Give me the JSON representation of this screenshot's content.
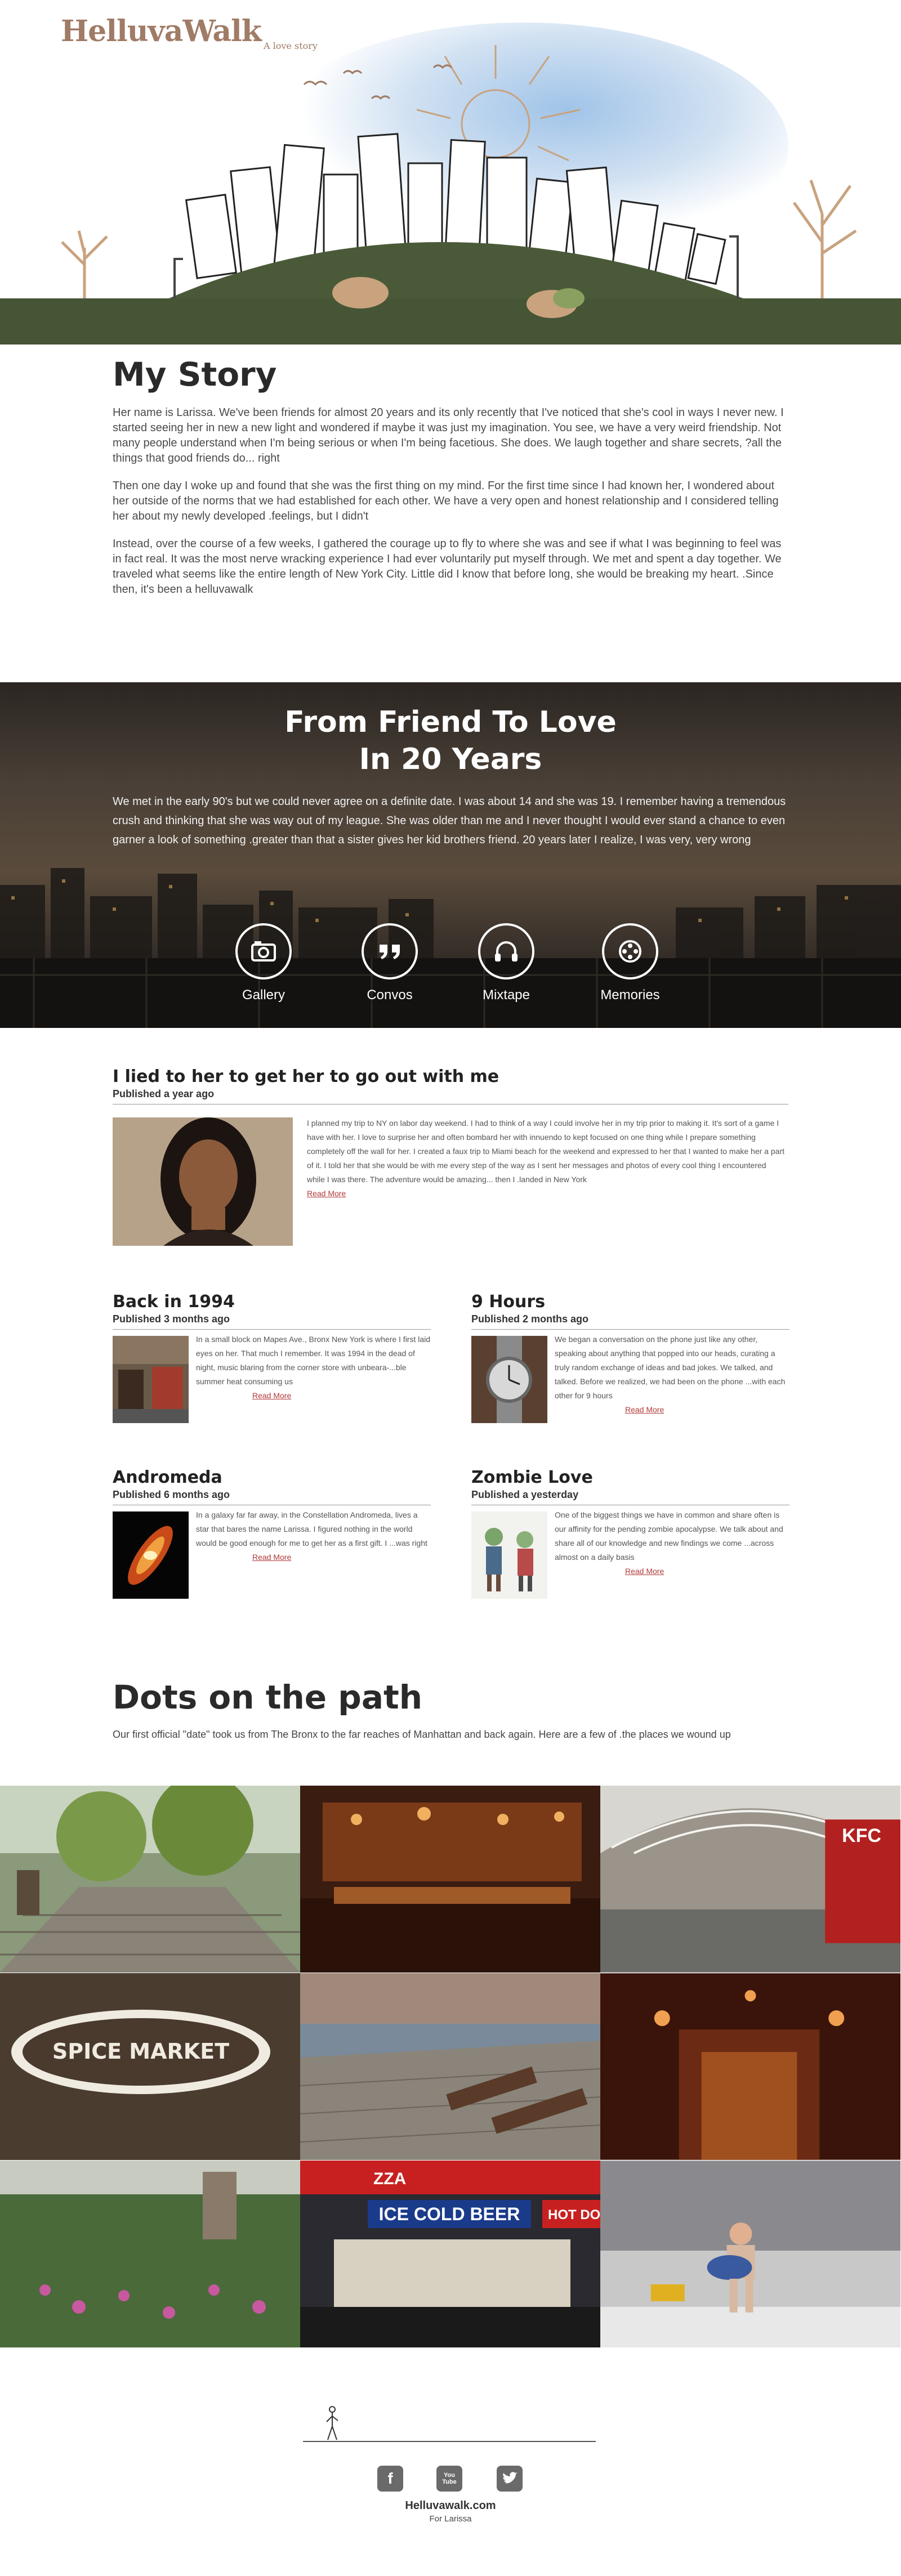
{
  "brand": {
    "title": "HelluvaWalk",
    "tagline": "A love story"
  },
  "story": {
    "title": "My Story",
    "paragraphs": [
      "Her name is Larissa. We've been friends for almost 20 years and its only recently that I've noticed that she's cool in ways I never new. I started seeing her in new a new light and wondered if maybe it was just my imagination. You see, we have a very weird friendship. Not many people understand when I'm being serious or when I'm being facetious. She does. We laugh together and share secrets, ?all the things that good friends do... right",
      "Then one day I woke up and found that she was the first thing on my mind. For the first time since I had known her, I wondered about her outside of the norms that we had established for each other. We have a very open and honest relationship and I considered telling her about my newly developed .feelings, but I didn't",
      "Instead, over the course of a few weeks, I gathered the courage up to fly to where she was and see if what I was beginning to feel was in fact real. It was the most nerve wracking experience I had ever voluntarily put myself through. We met and spent a day together. We traveled what seems like the entire length of New York City. Little did I know that before long, she would be breaking my heart. .Since then, it's been a helluvawalk"
    ]
  },
  "band": {
    "title_line1": "From Friend To Love",
    "title_line2": "In 20 Years",
    "text": "We met in the early 90's but we could never agree on a definite date. I was about 14 and she was 19. I remember having a tremendous crush and thinking that she was way out of my league. She was older than me and I never thought I would ever stand a chance to even garner a look of something .greater than that a sister gives her kid brothers friend. 20 years later I realize, I was very, very wrong",
    "buttons": [
      {
        "label": "Gallery",
        "icon": "camera-icon"
      },
      {
        "label": "Convos",
        "icon": "quote-icon"
      },
      {
        "label": "Mixtape",
        "icon": "headphones-icon"
      },
      {
        "label": "Memories",
        "icon": "film-reel-icon"
      }
    ]
  },
  "posts": {
    "read_more": "Read More",
    "main": {
      "title": "I lied to her to get her to go out with me",
      "meta": "Published a year ago",
      "body": "I planned my trip to NY on labor day weekend. I had to think of a way I could involve her in my trip prior to making it. It's sort of a game I have with her. I love to surprise her and often bombard her with innuendo to kept focused on one thing while I prepare something completely off the wall for her. I created a faux trip to Miami beach for the weekend and expressed to her that I wanted to make her a part of it. I told her that she would be with me every step of the way as I sent her messages and photos of every cool thing I encountered while I was there. The adventure would be amazing... then I .landed in New York"
    },
    "grid": [
      {
        "title": "Back in 1994",
        "meta": "Published 3 months ago",
        "body": "In a small block on Mapes Ave., Bronx New York is where I first laid eyes on her. That much I remember. It was 1994 in the dead of night, music blaring from the corner store with unbeara-...ble summer heat consuming us"
      },
      {
        "title": "9 Hours",
        "meta": "Published 2 months ago",
        "body": "We began a conversation on the phone just like any other, speaking about anything that popped into our heads, curating a truly random exchange of ideas and bad jokes. We talked, and talked. Before we realized, we had been on the phone ...with each other for 9 hours"
      },
      {
        "title": "Andromeda",
        "meta": "Published 6 months ago",
        "body": "In a galaxy far far away, in the Constellation Andromeda, lives a star that bares the name Larissa. I figured nothing in the world would be good enough for me to get her as a first gift. I ...was right"
      },
      {
        "title": "Zombie Love",
        "meta": "Published a yesterday",
        "body": "One of the biggest things we have in common and share often is our affinity for the pending zombie apocalypse. We talk about and share all of our knowledge and new findings we come ...across almost on a daily basis"
      }
    ]
  },
  "dots": {
    "title": "Dots on the path",
    "text": "Our first official \"date\" took us from The Bronx to the far reaches of Manhattan and back again. Here are a few of .the places we wound up",
    "signs": {
      "spice": "SPICE MARKET",
      "beer": "ICE COLD BEER",
      "hotdog": "HOT DO",
      "kfc": "KFC",
      "pizza": "ZZA"
    }
  },
  "footer": {
    "site": "Helluvawalk.com",
    "for": "For Larissa",
    "social": [
      {
        "label": "f",
        "icon": "facebook-icon"
      },
      {
        "label": "You Tube",
        "icon": "youtube-icon"
      },
      {
        "label": "twitter",
        "icon": "twitter-icon"
      }
    ]
  },
  "colors": {
    "brand": "#a07b66",
    "hill": "#4a5a38",
    "link": "#b23a3a"
  }
}
